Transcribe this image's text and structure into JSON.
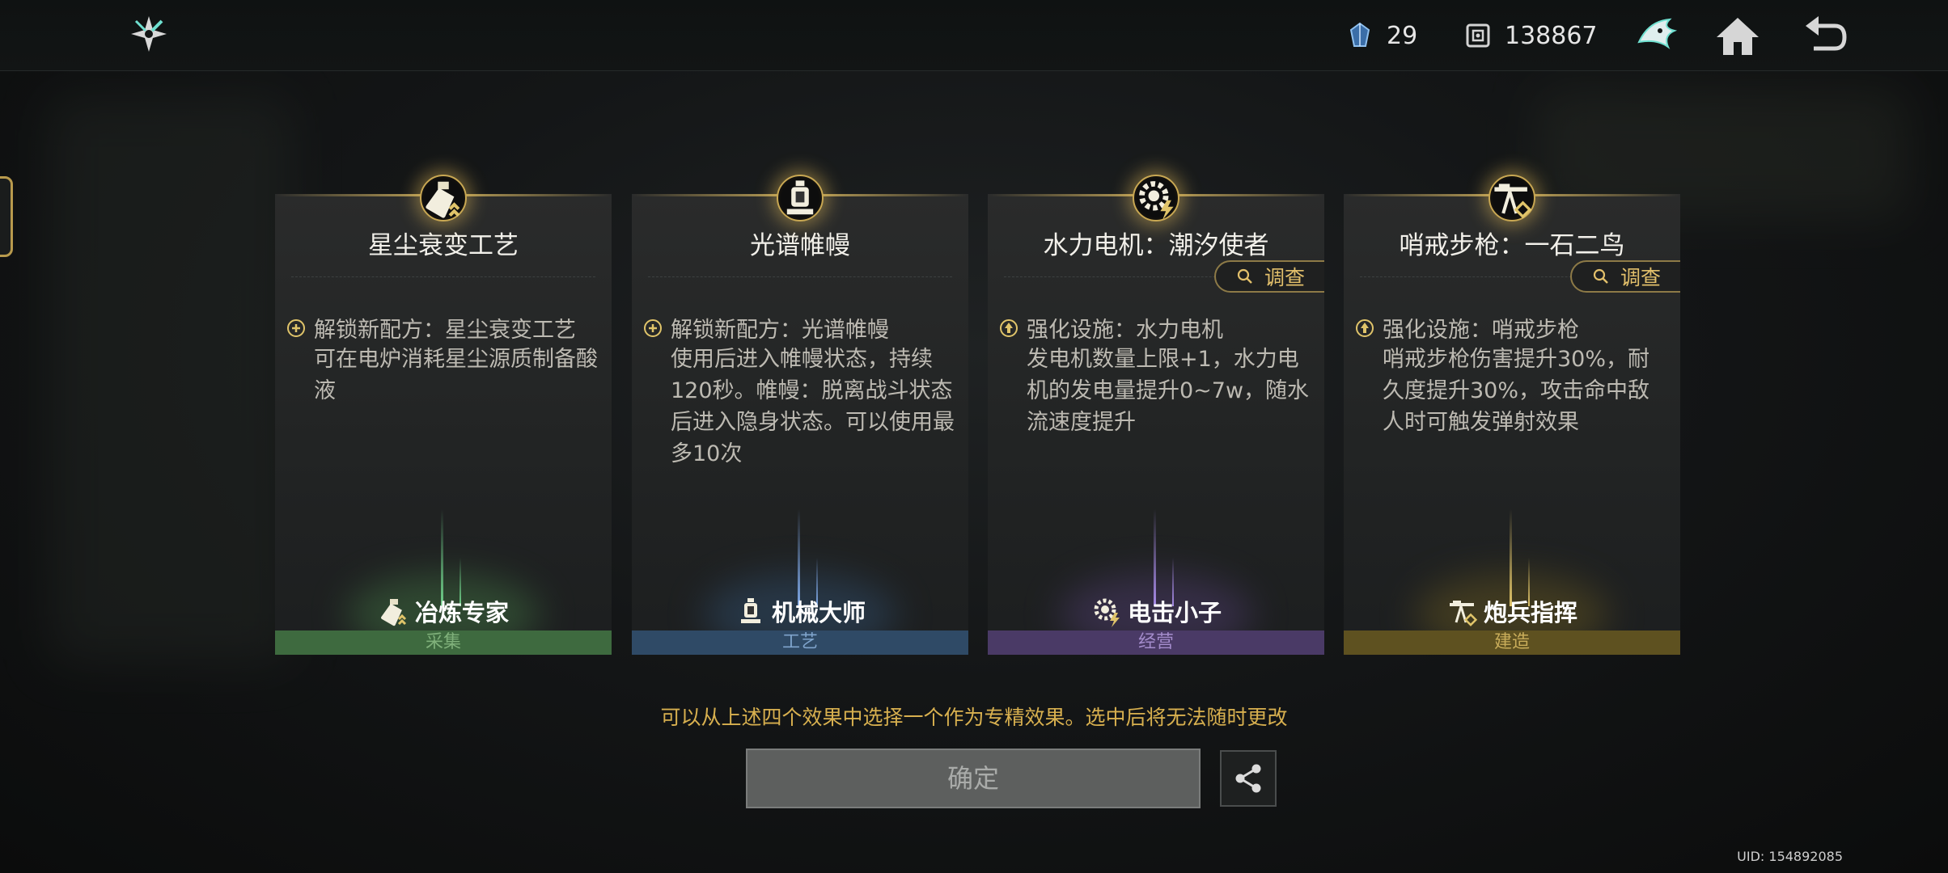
{
  "topbar": {
    "logo_icon": "shuriken-logo-icon",
    "resources": [
      {
        "icon": "crystal-icon",
        "value": "29"
      },
      {
        "icon": "dice-currency-icon",
        "value": "138867"
      }
    ],
    "buttons": [
      {
        "icon": "wolf-emblem-icon"
      },
      {
        "icon": "home-icon"
      },
      {
        "icon": "back-arrow-icon"
      }
    ]
  },
  "cards": [
    {
      "title": "星尘衰变工艺",
      "medal_icon": "bottle-icon",
      "effect": "解锁新配方：星尘衰变工艺",
      "effect_icon": "plus-circle-icon",
      "desc": "可在电炉消耗星尘源质制备酸液",
      "investigate": null,
      "badge": "冶炼专家",
      "badge_icon": "bottle-icon",
      "category": "采集",
      "category_color": "#3e6a3f",
      "category_text_color": "#7fb07a",
      "beam_color": "#6fcf8a"
    },
    {
      "title": "光谱帷幔",
      "medal_icon": "lantern-icon",
      "effect": "解锁新配方：光谱帷幔",
      "effect_icon": "plus-circle-icon",
      "desc": "使用后进入帷幔状态，持续120秒。帷幔：脱离战斗状态后进入隐身状态。可以使用最多10次",
      "investigate": null,
      "badge": "机械大师",
      "badge_icon": "lantern-icon",
      "category": "工艺",
      "category_color": "#2f4a66",
      "category_text_color": "#7fa4cc",
      "beam_color": "#7fa8e6"
    },
    {
      "title": "水力电机：潮汐使者",
      "medal_icon": "gear-bolt-icon",
      "effect": "强化设施：水力电机",
      "effect_icon": "up-arrow-circle-icon",
      "desc": "发电机数量上限+1，水力电机的发电量提升0~7w，随水流速度提升",
      "investigate": "调查",
      "badge": "电击小子",
      "badge_icon": "gear-bolt-icon",
      "category": "经营",
      "category_color": "#4a3a66",
      "category_text_color": "#a48ccc",
      "beam_color": "#a78be6"
    },
    {
      "title": "哨戒步枪：一石二鸟",
      "medal_icon": "rifle-icon",
      "effect": "强化设施：哨戒步枪",
      "effect_icon": "up-arrow-circle-icon",
      "desc": "哨戒步枪伤害提升30%，耐久度提升30%，攻击命中敌人时可触发弹射效果",
      "investigate": "调查",
      "badge": "炮兵指挥",
      "badge_icon": "rifle-icon",
      "category": "建造",
      "category_color": "#5e5120",
      "category_text_color": "#c9ad5a",
      "beam_color": "#e0c46a"
    }
  ],
  "hint": "可以从上述四个效果中选择一个作为专精效果。选中后将无法随时更改",
  "confirm_label": "确定",
  "share_icon": "share-icon",
  "uid": "UID: 154892085",
  "colors": {
    "gold": "#c9a853",
    "hint": "#d8b04f"
  }
}
